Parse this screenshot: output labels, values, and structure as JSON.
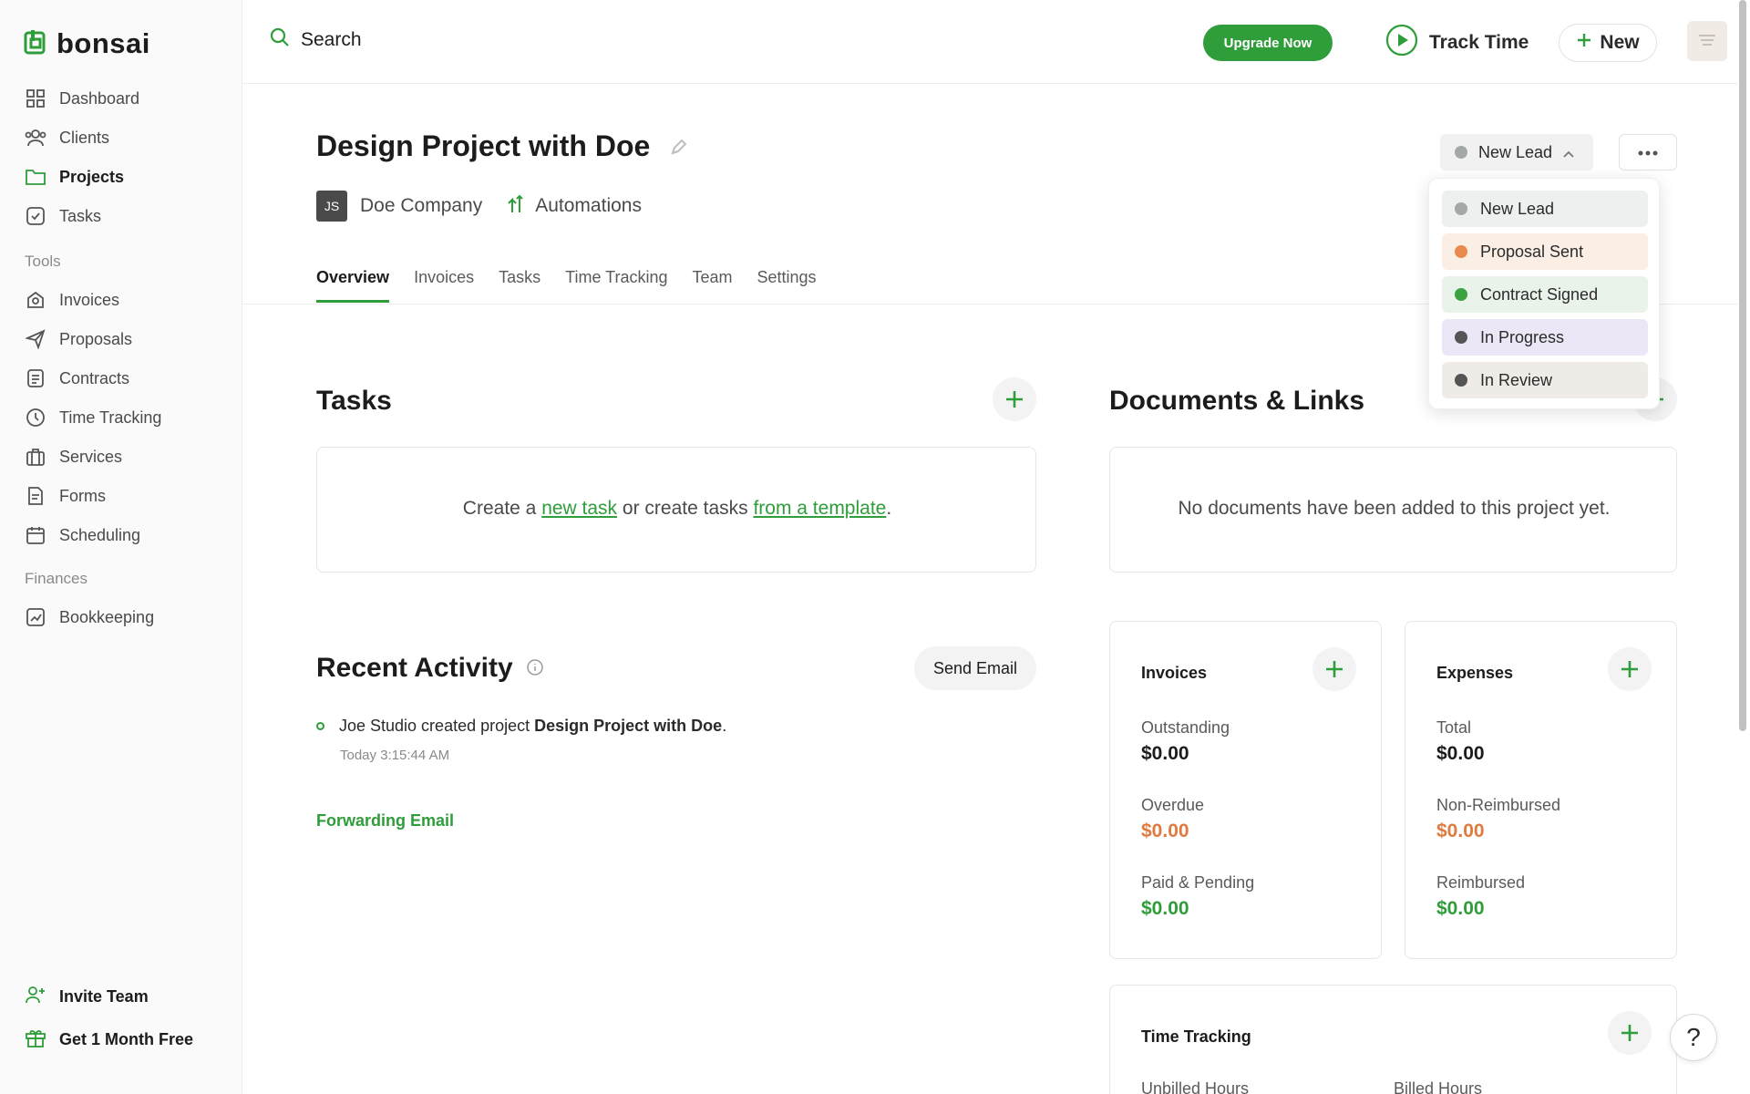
{
  "app": {
    "logo_text": "bonsai"
  },
  "sidebar": {
    "main": [
      {
        "label": "Dashboard",
        "icon": "dashboard-icon"
      },
      {
        "label": "Clients",
        "icon": "clients-icon"
      },
      {
        "label": "Projects",
        "icon": "folder-icon",
        "active": true
      },
      {
        "label": "Tasks",
        "icon": "tasks-icon"
      }
    ],
    "tools_heading": "Tools",
    "tools": [
      {
        "label": "Invoices",
        "icon": "invoice-icon"
      },
      {
        "label": "Proposals",
        "icon": "send-icon"
      },
      {
        "label": "Contracts",
        "icon": "contract-icon"
      },
      {
        "label": "Time Tracking",
        "icon": "clock-icon"
      },
      {
        "label": "Services",
        "icon": "briefcase-icon"
      },
      {
        "label": "Forms",
        "icon": "form-icon"
      },
      {
        "label": "Scheduling",
        "icon": "calendar-icon"
      }
    ],
    "finances_heading": "Finances",
    "finances": [
      {
        "label": "Bookkeeping",
        "icon": "chart-icon"
      }
    ],
    "bottom": {
      "invite": "Invite Team",
      "free_month": "Get 1 Month Free"
    }
  },
  "topbar": {
    "search_label": "Search",
    "upgrade_label": "Upgrade Now",
    "track_time_label": "Track Time",
    "new_label": "New"
  },
  "project": {
    "title": "Design Project with Doe",
    "client_initials": "JS",
    "client_name": "Doe Company",
    "automations_label": "Automations",
    "status": "New Lead"
  },
  "tabs": [
    "Overview",
    "Invoices",
    "Tasks",
    "Time Tracking",
    "Team",
    "Settings"
  ],
  "status_dropdown": [
    {
      "label": "New Lead",
      "dot": "#a3a7a8",
      "bg": "#eef0f0"
    },
    {
      "label": "Proposal Sent",
      "dot": "#e88a4e",
      "bg": "#fbeee5"
    },
    {
      "label": "Contract Signed",
      "dot": "#3aa33f",
      "bg": "#eaf3ea"
    },
    {
      "label": "In Progress",
      "dot": "#555555",
      "bg": "#ece7f7"
    },
    {
      "label": "In Review",
      "dot": "#555555",
      "bg": "#efebe7"
    }
  ],
  "tasks_section": {
    "title": "Tasks",
    "empty_prefix": "Create a ",
    "new_task_link": "new task",
    "middle": " or create tasks ",
    "template_link": "from a template",
    "suffix": "."
  },
  "documents_section": {
    "title": "Documents & Links",
    "empty": "No documents have been added to this project yet."
  },
  "activity": {
    "title": "Recent Activity",
    "send_email": "Send Email",
    "item_prefix": "Joe Studio created project ",
    "item_bold": "Design Project with Doe",
    "item_suffix": ".",
    "item_time": "Today 3:15:44 AM",
    "forwarding": "Forwarding Email"
  },
  "invoices_card": {
    "title": "Invoices",
    "outstanding_label": "Outstanding",
    "outstanding": "$0.00",
    "overdue_label": "Overdue",
    "overdue": "$0.00",
    "paid_label": "Paid & Pending",
    "paid": "$0.00"
  },
  "expenses_card": {
    "title": "Expenses",
    "total_label": "Total",
    "total": "$0.00",
    "nonreimb_label": "Non-Reimbursed",
    "nonreimb": "$0.00",
    "reimb_label": "Reimbursed",
    "reimb": "$0.00"
  },
  "time_card": {
    "title": "Time Tracking",
    "unbilled_label": "Unbilled Hours",
    "billed_label": "Billed Hours"
  },
  "help_label": "?",
  "colors": {
    "accent": "#2f9d3a",
    "warning": "#e07a3f"
  }
}
